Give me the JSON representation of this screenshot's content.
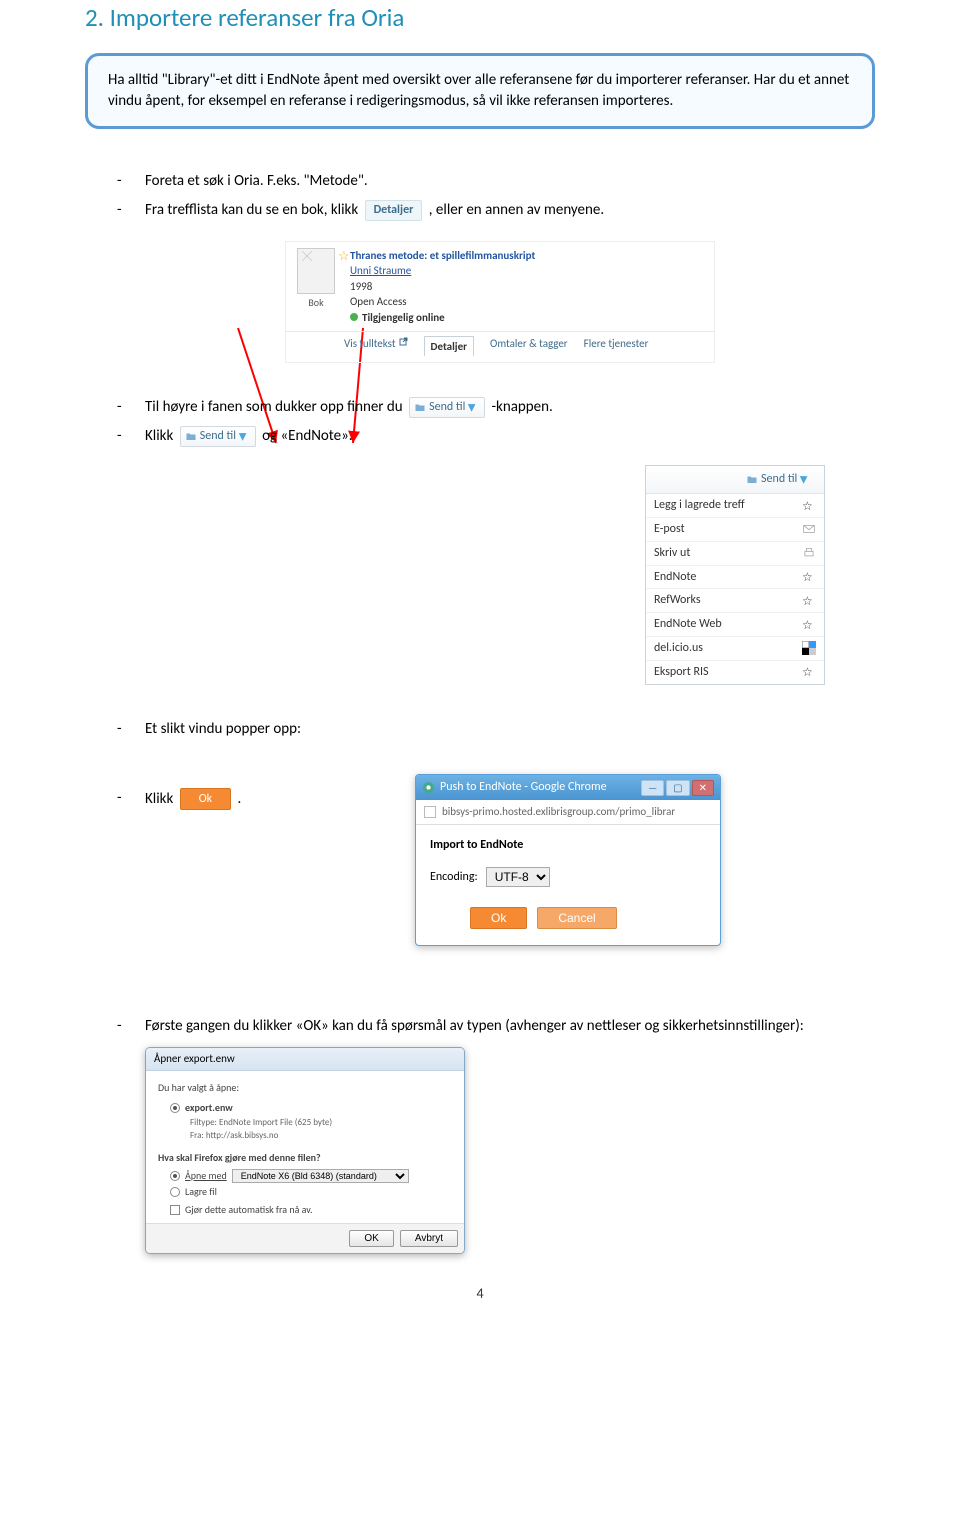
{
  "heading": "2. Importere referanser fra Oria",
  "callout_text": "Ha alltid \"Library\"-et ditt i EndNote åpent med oversikt over alle referansene før du importerer referanser. Har du et annet vindu åpent, for eksempel en referanse i redigeringsmodus, så vil ikke referansen importeres.",
  "b1a": "Foreta et søk i Oria. F.eks. \"Metode\".",
  "b1b_pre": "Fra trefflista kan du se en bok, klikk ",
  "b1b_post": ", eller en annen av menyene.",
  "detaljer_label": "Detaljer",
  "oria": {
    "bok_label": "Bok",
    "title": "Thranes metode: et spillefilmmanuskript",
    "author": "Unni Straume",
    "year": "1998",
    "open_access": "Open Access",
    "avail": "Tilgjengelig online",
    "tabs": [
      "Vis fulltekst",
      "Detaljer",
      "Omtaler & tagger",
      "Flere tjenester"
    ]
  },
  "b2_pre": "Til høyre i fanen som dukker opp finner du ",
  "b2_post": " -knappen.",
  "b3_pre": "Klikk ",
  "b3_post": "  og «EndNote».",
  "sendtil_label": "Send til",
  "sendtil_items": [
    "Legg i lagrede treff",
    "E-post",
    "Skriv ut",
    "EndNote",
    "RefWorks",
    "EndNote Web",
    "del.icio.us",
    "Eksport RIS"
  ],
  "b4": "Et slikt vindu popper opp:",
  "b5_pre": "Klikk ",
  "b5_post": ".",
  "ok_label": "Ok",
  "chrome": {
    "title": "Push to EndNote - Google Chrome",
    "url": "bibsys-primo.hosted.exlibrisgroup.com/primo_librar",
    "heading": "Import to EndNote",
    "enc_label": "Encoding:",
    "enc_value": "UTF-8",
    "ok": "Ok",
    "cancel": "Cancel"
  },
  "b6": "Første gangen du klikker «OK» kan du få spørsmål av typen (avhenger av nettleser og sikkerhetsinnstillinger):",
  "export": {
    "title": "Åpner export.enw",
    "q1": "Du har valgt å åpne:",
    "filename": "export.enw",
    "filetype": "Filtype: EndNote Import File (625 byte)",
    "from": "Fra: http://ask.bibsys.no",
    "q2": "Hva skal Firefox gjøre med denne filen?",
    "open": "Åpne med",
    "open_app": "EndNote X6 (Bld 6348) (standard)",
    "save": "Lagre fil",
    "auto": "Gjør dette automatisk fra nå av.",
    "ok": "OK",
    "cancel": "Avbryt"
  },
  "pagenum": "4"
}
